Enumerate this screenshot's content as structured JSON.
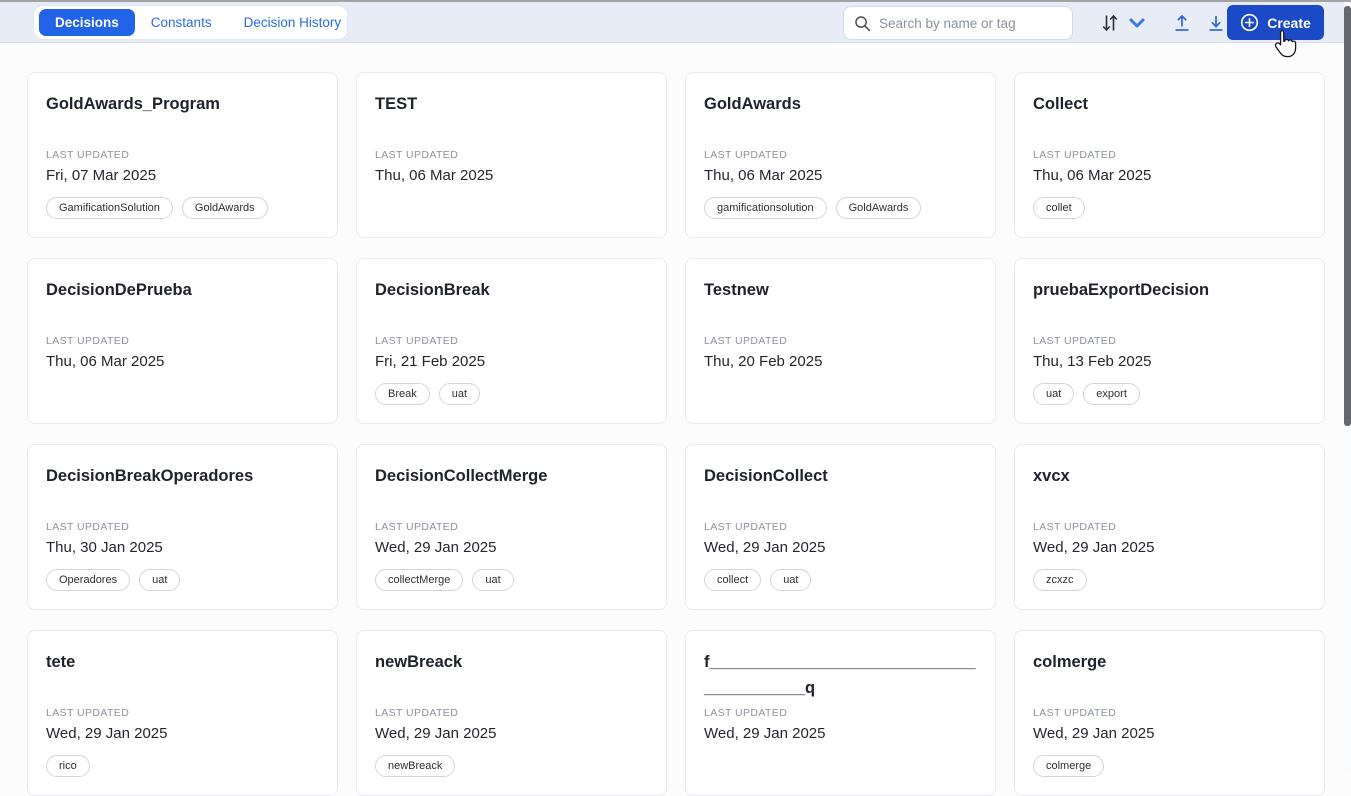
{
  "topbar": {
    "tabs": [
      {
        "label": "Decisions",
        "active": true
      },
      {
        "label": "Constants",
        "active": false
      },
      {
        "label": "Decision History",
        "active": false
      }
    ],
    "search_placeholder": "Search by name or tag",
    "create_label": "Create"
  },
  "labels": {
    "last_updated": "LAST UPDATED"
  },
  "cards": [
    {
      "title": "GoldAwards_Program",
      "date": "Fri, 07 Mar 2025",
      "tags": [
        "GamificationSolution",
        "GoldAwards"
      ]
    },
    {
      "title": "TEST",
      "date": "Thu, 06 Mar 2025",
      "tags": []
    },
    {
      "title": "GoldAwards",
      "date": "Thu, 06 Mar 2025",
      "tags": [
        "gamificationsolution",
        "GoldAwards"
      ]
    },
    {
      "title": "Collect",
      "date": "Thu, 06 Mar 2025",
      "tags": [
        "collet"
      ]
    },
    {
      "title": "DecisionDePrueba",
      "date": "Thu, 06 Mar 2025",
      "tags": []
    },
    {
      "title": "DecisionBreak",
      "date": "Fri, 21 Feb 2025",
      "tags": [
        "Break",
        "uat"
      ]
    },
    {
      "title": "Testnew",
      "date": "Thu, 20 Feb 2025",
      "tags": []
    },
    {
      "title": "pruebaExportDecision",
      "date": "Thu, 13 Feb 2025",
      "tags": [
        "uat",
        "export"
      ]
    },
    {
      "title": "DecisionBreakOperadores",
      "date": "Thu, 30 Jan 2025",
      "tags": [
        "Operadores",
        "uat"
      ]
    },
    {
      "title": "DecisionCollectMerge",
      "date": "Wed, 29 Jan 2025",
      "tags": [
        "collectMerge",
        "uat"
      ]
    },
    {
      "title": "DecisionCollect",
      "date": "Wed, 29 Jan 2025",
      "tags": [
        "collect",
        "uat"
      ]
    },
    {
      "title": "xvcx",
      "date": "Wed, 29 Jan 2025",
      "tags": [
        "zcxzc"
      ]
    },
    {
      "title": "tete",
      "date": "Wed, 29 Jan 2025",
      "tags": [
        "rico"
      ]
    },
    {
      "title": "newBreack",
      "date": "Wed, 29 Jan 2025",
      "tags": [
        "newBreack"
      ]
    },
    {
      "title": "f________________________________________q",
      "date": "Wed, 29 Jan 2025",
      "tags": []
    },
    {
      "title": "colmerge",
      "date": "Wed, 29 Jan 2025",
      "tags": [
        "colmerge"
      ]
    }
  ],
  "icons": [
    "search-icon",
    "sort-arrows-icon",
    "chevron-down-icon",
    "upload-icon",
    "download-icon",
    "plus-circle-icon",
    "cursor-pointer"
  ],
  "colors": {
    "topbar_bg": "#e7ecf7",
    "active_tab_blue": "#2263e7",
    "link_blue": "#2d6ae3",
    "create_button_blue": "#1c49c5",
    "card_border": "#e8ebf0",
    "tag_border": "#d2d6dc",
    "muted_text": "#8d929b",
    "title_text": "#20232b",
    "scrollbar_thumb": "#64686c"
  }
}
